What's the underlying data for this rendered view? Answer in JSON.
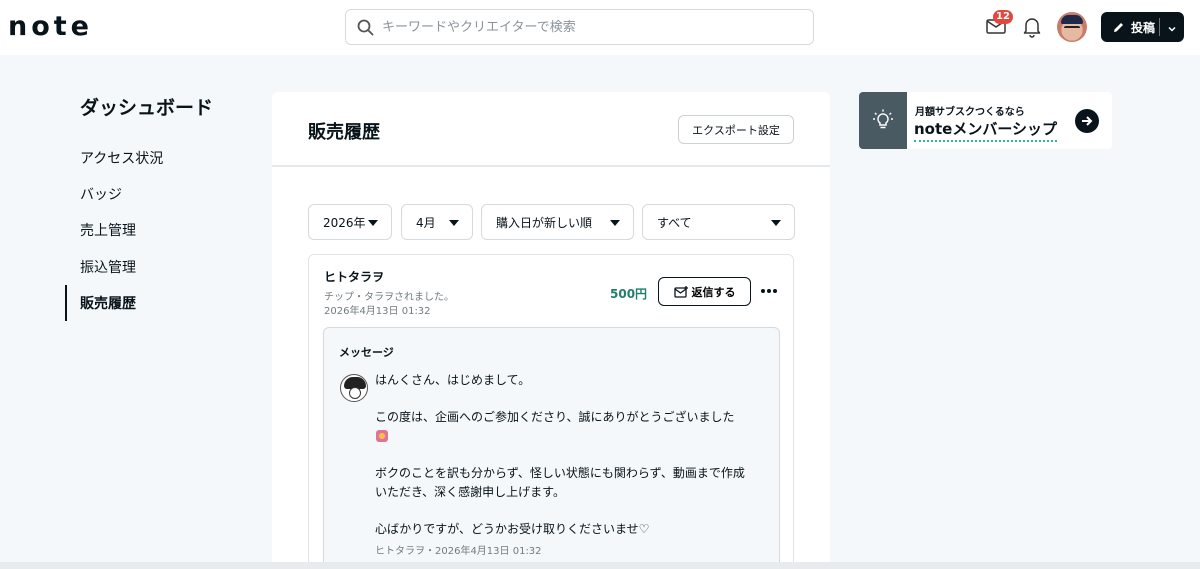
{
  "header": {
    "logo": "note",
    "search_placeholder": "キーワードやクリエイターで検索",
    "notification_count": "12",
    "post_label": "投稿"
  },
  "sidebar": {
    "title": "ダッシュボード",
    "items": [
      {
        "label": "アクセス状況"
      },
      {
        "label": "バッジ"
      },
      {
        "label": "売上管理"
      },
      {
        "label": "振込管理"
      },
      {
        "label": "販売履歴",
        "active": true
      }
    ]
  },
  "main": {
    "title": "販売履歴",
    "export_label": "エクスポート設定",
    "filters": {
      "year": "2026年",
      "month": "4月",
      "sort": "購入日が新しい順",
      "type": "すべて"
    },
    "sale": {
      "buyer": "ヒトタラヲ",
      "description": "チップ・タラヲされました。",
      "date": "2026年4月13日 01:32",
      "price": "500円",
      "reply_label": "返信する",
      "message": {
        "label": "メッセージ",
        "lines": [
          "はんくさん、はじめまして。",
          "この度は、企画へのご参加くださり、誠にありがとうございました",
          "ボクのことを訳も分からず、怪しい状態にも関わらず、動画まで作成",
          "いただき、深く感謝申し上げます。",
          "心ばかりですが、どうかお受け取りくださいませ♡"
        ],
        "meta": "ヒトタラヲ・2026年4月13日 01:32"
      }
    }
  },
  "banner": {
    "subtitle": "月額サブスクつくるなら",
    "title": "noteメンバーシップ"
  },
  "colors": {
    "accent_green": "#1f7f6b",
    "badge_red": "#e2483d",
    "dark": "#08131a",
    "banner_icon_bg": "#4a5a63"
  },
  "icons": [
    "search-icon",
    "mail-icon",
    "bell-icon",
    "pen-icon",
    "chevron-down-icon",
    "reply-icon",
    "more-icon",
    "bulb-icon",
    "arrow-right-icon",
    "caret-down-icon"
  ]
}
